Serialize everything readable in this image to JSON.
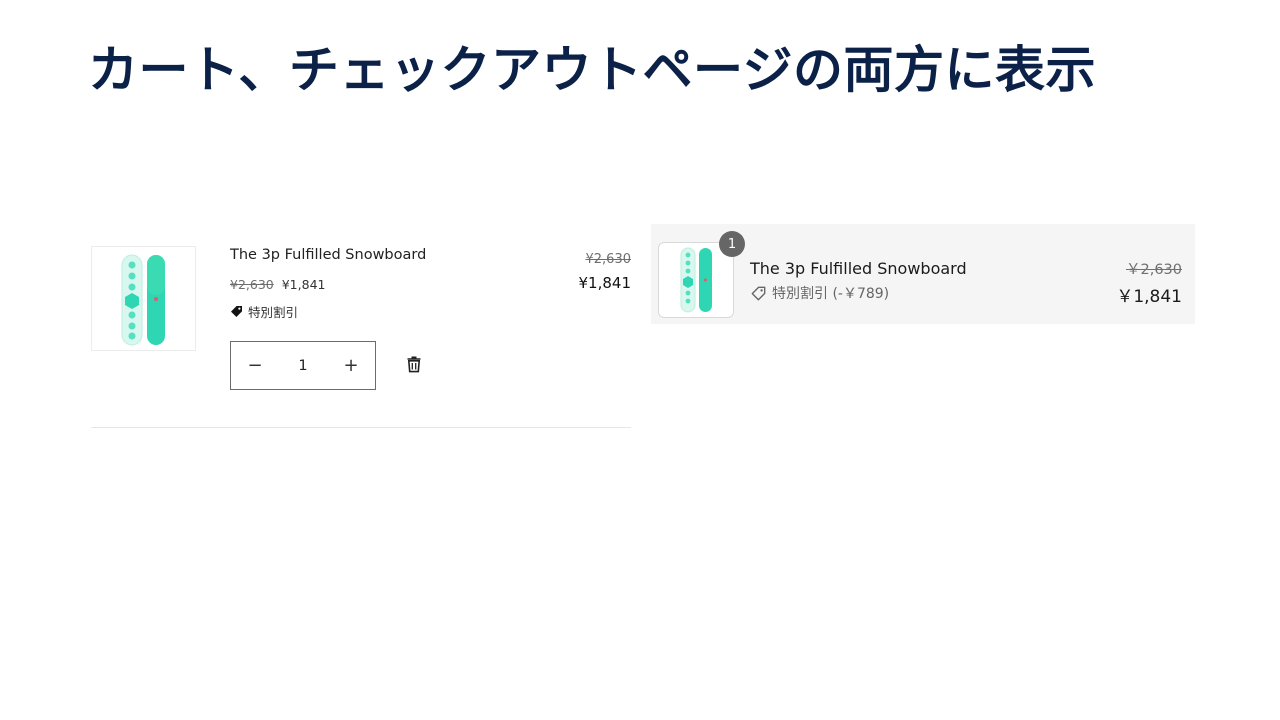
{
  "slide": {
    "title": "カート、チェックアウトページの両方に表示"
  },
  "cart": {
    "product_title": "The 3p Fulfilled Snowboard",
    "original_price": "¥2,630",
    "sale_price": "¥1,841",
    "discount_label": "特別割引",
    "total_original": "¥2,630",
    "total": "¥1,841",
    "quantity": "1",
    "decrease_label": "−",
    "increase_label": "+"
  },
  "checkout": {
    "quantity_badge": "1",
    "product_title": "The 3p Fulfilled Snowboard",
    "discount_label": "特別割引 (-￥789)",
    "original_price": "￥2,630",
    "total": "￥1,841"
  },
  "colors": {
    "title": "#0b2148",
    "board_mint": "#2fd6b4",
    "board_light": "#d8f7ee"
  },
  "icons": {
    "discount": "tag-icon",
    "remove": "trash-icon"
  }
}
